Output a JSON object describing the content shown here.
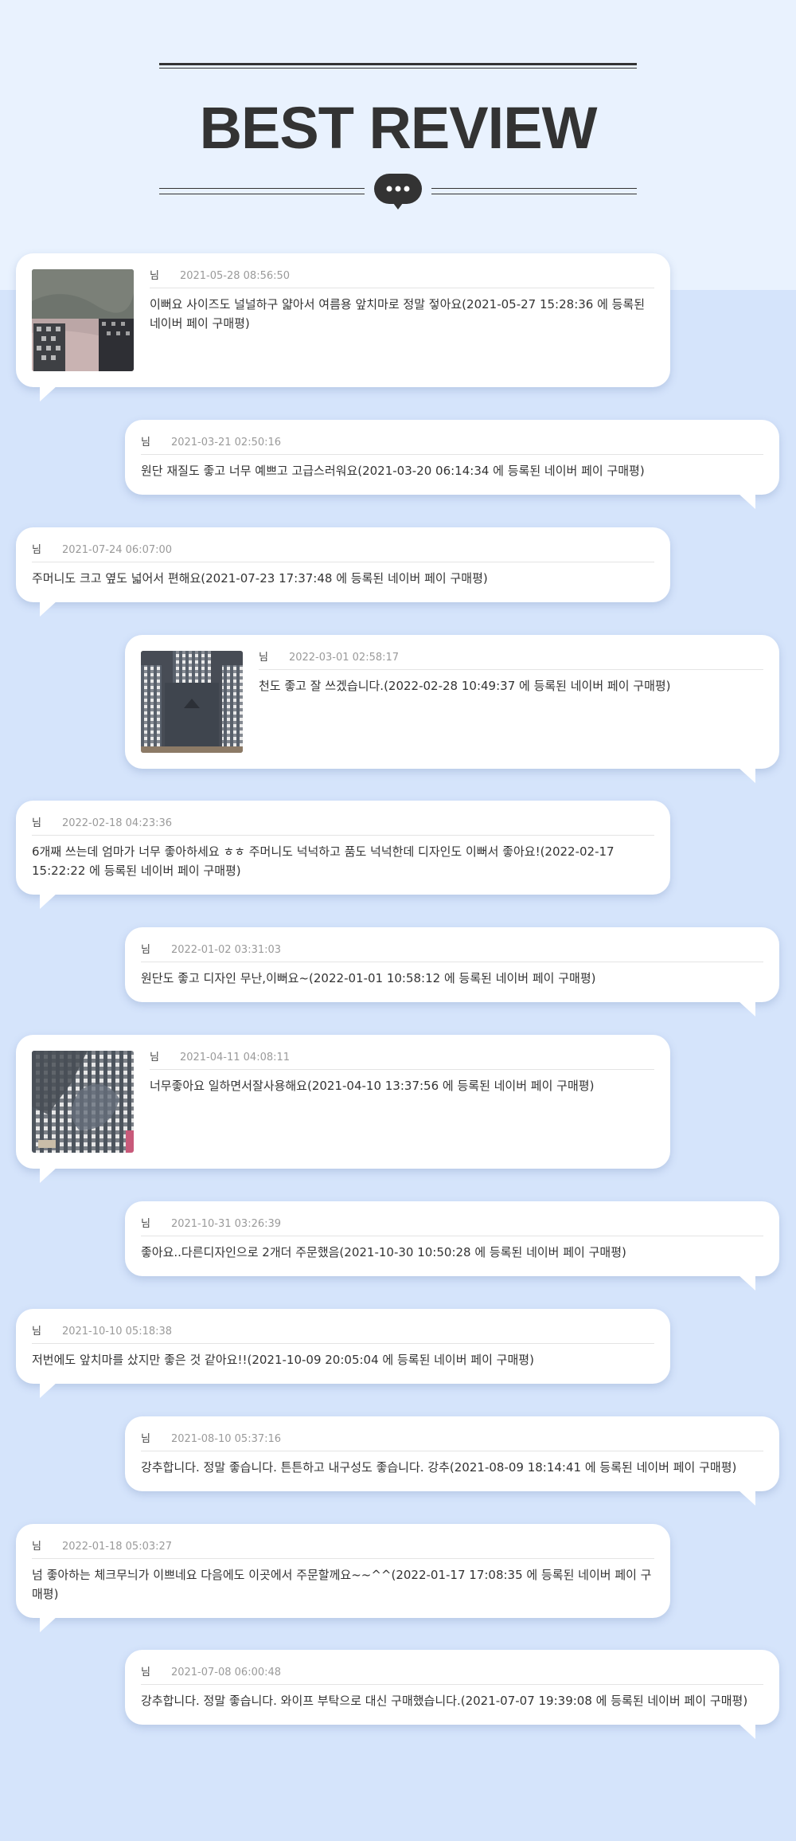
{
  "page": {
    "title": "BEST REVIEW",
    "colors": {
      "background": "#d5e4fb",
      "header_band": "#e9f2fe",
      "title": "#333333",
      "card": "#ffffff"
    },
    "icons": [
      "chat-bubble-icon"
    ]
  },
  "reviews": [
    {
      "side": "left",
      "has_photo": true,
      "photo_style": "fabric-gray-pink",
      "user": "님",
      "date": "2021-05-28 08:56:50",
      "text": "이뻐요 사이즈도 널널하구 얇아서 여름용 앞치마로 정말 젛아요(2021-05-27 15:28:36 에 등록된 네이버 페이 구매평)"
    },
    {
      "side": "right",
      "has_photo": false,
      "user": "님",
      "date": "2021-03-21 02:50:16",
      "text": "원단 재질도 좋고 너무 예쁘고 고급스러워요(2021-03-20 06:14:34 에 등록된 네이버 페이 구매평)"
    },
    {
      "side": "left",
      "has_photo": false,
      "user": "님",
      "date": "2021-07-24 06:07:00",
      "text": "주머니도 크고 옆도 넓어서 편해요(2021-07-23 17:37:48 에 등록된 네이버 페이 구매평)"
    },
    {
      "side": "right",
      "has_photo": true,
      "photo_style": "gingham-apron",
      "user": "님",
      "date": "2022-03-01 02:58:17",
      "text": "천도 좋고 잘 쓰겠습니다.(2022-02-28 10:49:37 에 등록된 네이버 페이 구매평)"
    },
    {
      "side": "left",
      "has_photo": false,
      "user": "님",
      "date": "2022-02-18 04:23:36",
      "text": "6개째 쓰는데 엄마가 너무 좋아하세요 ㅎㅎ 주머니도 넉넉하고 품도 넉넉한데 디자인도 이뻐서 좋아요!(2022-02-17 15:22:22 에 등록된 네이버 페이 구매평)"
    },
    {
      "side": "right",
      "has_photo": false,
      "user": "님",
      "date": "2022-01-02 03:31:03",
      "text": "원단도 좋고 디자인 무난,이뻐요~(2022-01-01 10:58:12 에 등록된 네이버 페이 구매평)"
    },
    {
      "side": "left",
      "has_photo": true,
      "photo_style": "packaged-gingham",
      "user": "님",
      "date": "2021-04-11 04:08:11",
      "text": "너무좋아요 일하면서잘사용해요(2021-04-10 13:37:56 에 등록된 네이버 페이 구매평)"
    },
    {
      "side": "right",
      "has_photo": false,
      "user": "님",
      "date": "2021-10-31 03:26:39",
      "text": "좋아요..다른디자인으로 2개더 주문했음(2021-10-30 10:50:28 에 등록된 네이버 페이 구매평)"
    },
    {
      "side": "left",
      "has_photo": false,
      "user": "님",
      "date": "2021-10-10 05:18:38",
      "text": "저번에도 앞치마를 샀지만 좋은 것 같아요!!(2021-10-09 20:05:04 에 등록된 네이버 페이 구매평)"
    },
    {
      "side": "right",
      "has_photo": false,
      "user": "님",
      "date": "2021-08-10 05:37:16",
      "text": "강추합니다. 정말 좋습니다. 튼튼하고 내구성도 좋습니다. 강추(2021-08-09 18:14:41 에 등록된 네이버 페이 구매평)"
    },
    {
      "side": "left",
      "has_photo": false,
      "user": "님",
      "date": "2022-01-18 05:03:27",
      "text": "넘 좋아하는 체크무늬가 이쁘네요 다음에도 이곳에서 주문할께요~~^^(2022-01-17 17:08:35 에 등록된 네이버 페이 구매평)"
    },
    {
      "side": "right",
      "has_photo": false,
      "user": "님",
      "date": "2021-07-08 06:00:48",
      "text": "강추합니다. 정말 좋습니다. 와이프 부탁으로 대신 구매했습니다.(2021-07-07 19:39:08 에 등록된 네이버 페이 구매평)"
    }
  ]
}
